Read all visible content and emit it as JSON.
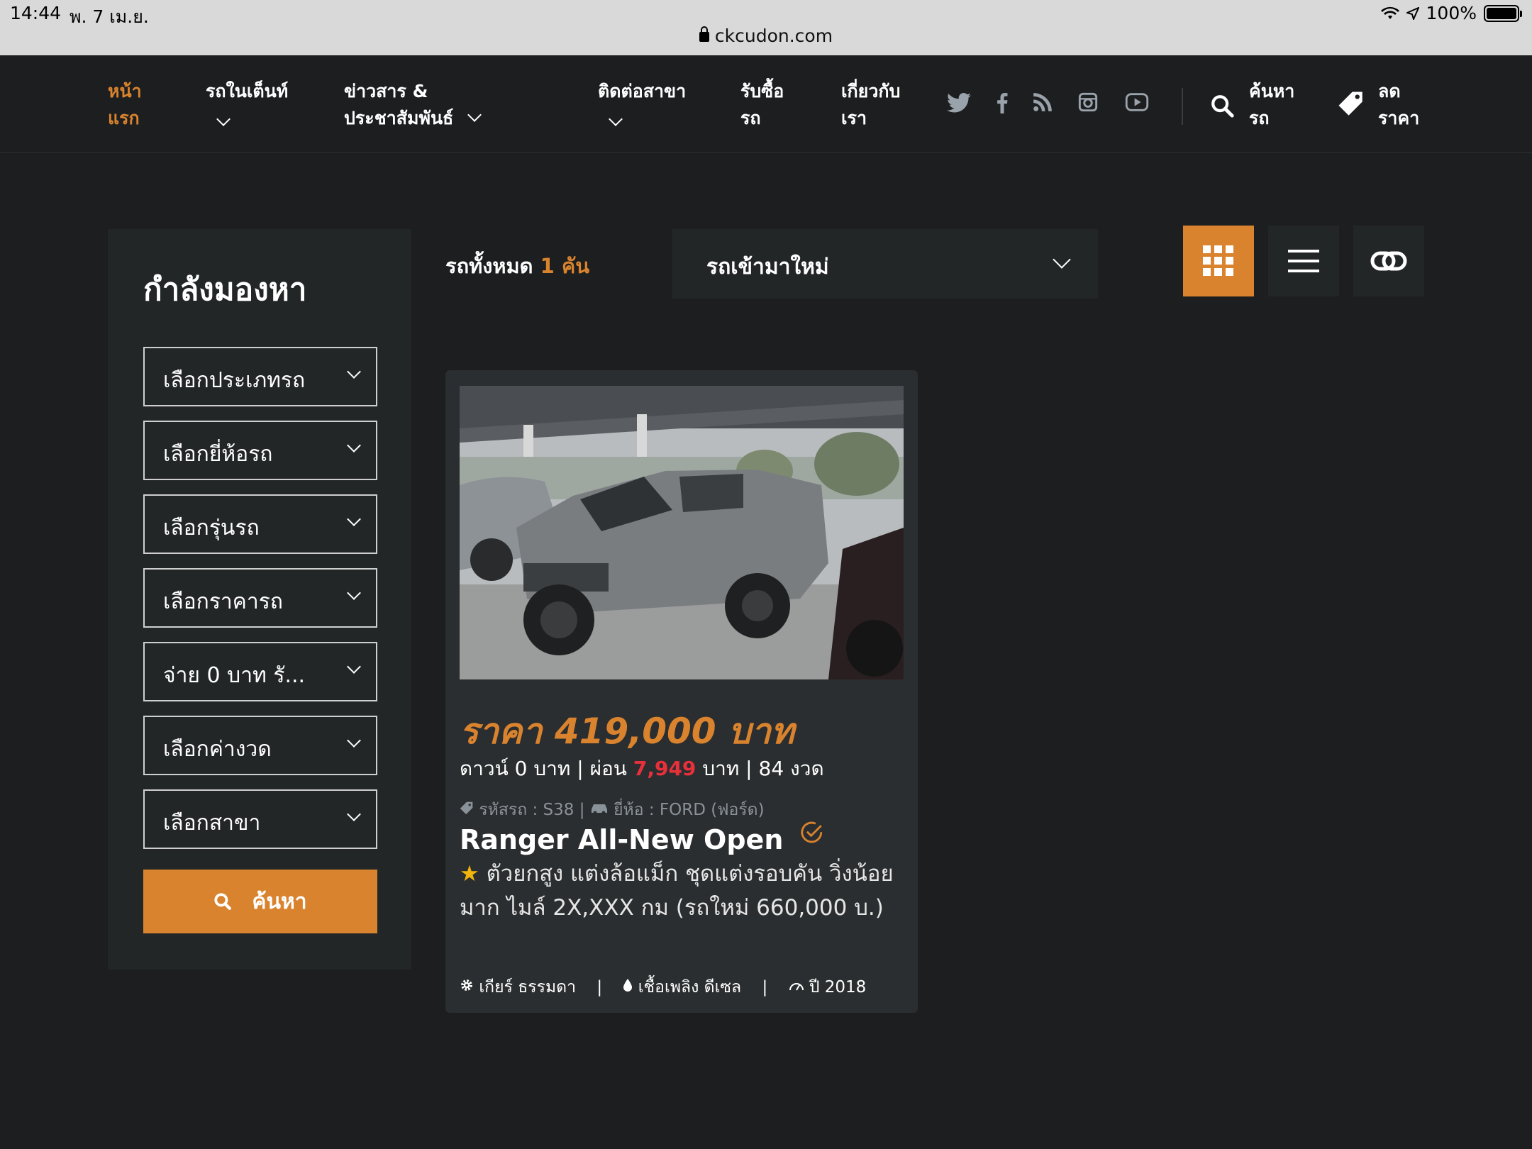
{
  "status_bar": {
    "time": "14:44",
    "date": "พ. 7 เม.ย.",
    "battery": "100%"
  },
  "browser": {
    "url": "ckcudon.com"
  },
  "nav": {
    "items": [
      {
        "line1": "หน้า",
        "line2": "แรก"
      },
      {
        "line1": "รถในเต็นท์"
      },
      {
        "line1": "ข่าวสาร &",
        "line2": "ประชาสัมพันธ์"
      },
      {
        "line1": "ติดต่อสาขา"
      },
      {
        "line1": "รับซื้อ",
        "line2": "รถ"
      },
      {
        "line1": "เกี่ยวกับ",
        "line2": "เรา"
      }
    ],
    "search": {
      "line1": "ค้นหา",
      "line2": "รถ"
    },
    "discount": {
      "line1": "ลด",
      "line2": "ราคา"
    },
    "social_icons": [
      "twitter-icon",
      "facebook-icon",
      "rss-icon",
      "instagram-icon",
      "youtube-icon"
    ]
  },
  "sidebar": {
    "title": "กำลังมองหา",
    "selects": [
      "เลือกประเภทรถ",
      "เลือกยี่ห้อรถ",
      "เลือกรุ่นรถ",
      "เลือกราคารถ",
      "จ่าย 0 บาท รั...",
      "เลือกค่างวด",
      "เลือกสาขา"
    ],
    "search_label": "ค้นหา"
  },
  "toolbar": {
    "total_prefix": "รถทั้งหมด",
    "total_count": "1 คัน",
    "sort_selected": "รถเข้ามาใหม่"
  },
  "car": {
    "price": "ราคา 419,000 บาท",
    "down_payment": "ดาวน์ 0 บาท | ผ่อน",
    "installment": "7,949",
    "terms_suffix": "บาท | 84 งวด",
    "code": "รหัสรถ : S38 |",
    "brand": "ยี่ห้อ : FORD (ฟอร์ด)",
    "title": "Ranger All-New Open",
    "description": "ตัวยกสูง แต่งล้อแม็ก ชุดแต่งรอบคัน วิ่งน้อยมาก ไมล์ 2X,XXX กม (รถใหม่ 660,000 บ.)",
    "gear": "เกียร์ ธรรมดา",
    "fuel": "เชื้อเพลิง ดีเซล",
    "year": "ปี 2018"
  },
  "colors": {
    "accent": "#d9832e",
    "background": "#1c1e1f",
    "panel": "#232627",
    "installment": "#e8303b"
  }
}
